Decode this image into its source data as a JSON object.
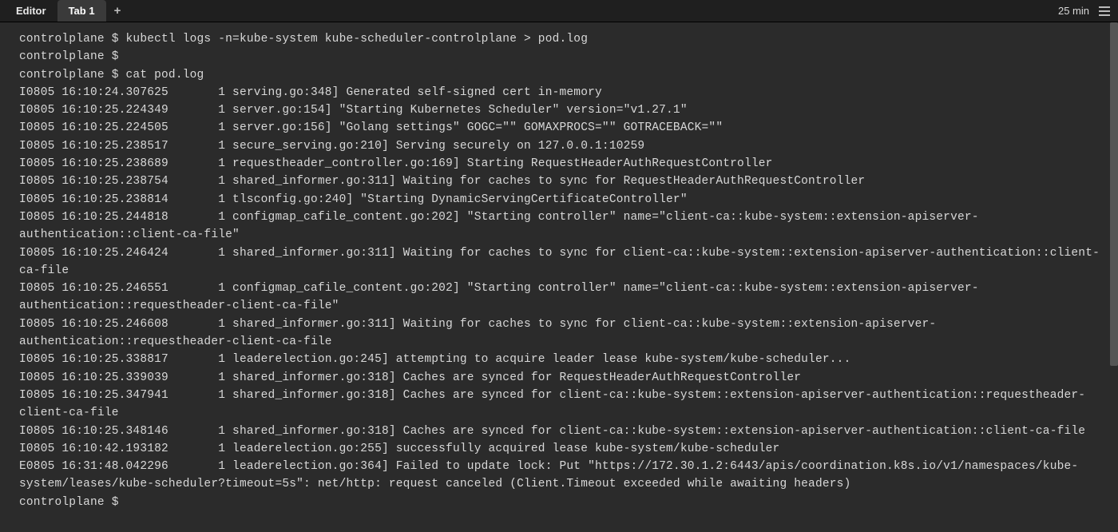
{
  "tabBar": {
    "editorLabel": "Editor",
    "tab1Label": "Tab 1",
    "newTabSymbol": "+",
    "timer": "25 min"
  },
  "terminal": {
    "lines": [
      "controlplane $ kubectl logs -n=kube-system kube-scheduler-controlplane > pod.log",
      "controlplane $",
      "controlplane $ cat pod.log",
      "I0805 16:10:24.307625       1 serving.go:348] Generated self-signed cert in-memory",
      "I0805 16:10:25.224349       1 server.go:154] \"Starting Kubernetes Scheduler\" version=\"v1.27.1\"",
      "I0805 16:10:25.224505       1 server.go:156] \"Golang settings\" GOGC=\"\" GOMAXPROCS=\"\" GOTRACEBACK=\"\"",
      "I0805 16:10:25.238517       1 secure_serving.go:210] Serving securely on 127.0.0.1:10259",
      "I0805 16:10:25.238689       1 requestheader_controller.go:169] Starting RequestHeaderAuthRequestController",
      "I0805 16:10:25.238754       1 shared_informer.go:311] Waiting for caches to sync for RequestHeaderAuthRequestController",
      "I0805 16:10:25.238814       1 tlsconfig.go:240] \"Starting DynamicServingCertificateController\"",
      "I0805 16:10:25.244818       1 configmap_cafile_content.go:202] \"Starting controller\" name=\"client-ca::kube-system::extension-apiserver-authentication::client-ca-file\"",
      "I0805 16:10:25.246424       1 shared_informer.go:311] Waiting for caches to sync for client-ca::kube-system::extension-apiserver-authentication::client-ca-file",
      "I0805 16:10:25.246551       1 configmap_cafile_content.go:202] \"Starting controller\" name=\"client-ca::kube-system::extension-apiserver-authentication::requestheader-client-ca-file\"",
      "I0805 16:10:25.246608       1 shared_informer.go:311] Waiting for caches to sync for client-ca::kube-system::extension-apiserver-authentication::requestheader-client-ca-file",
      "I0805 16:10:25.338817       1 leaderelection.go:245] attempting to acquire leader lease kube-system/kube-scheduler...",
      "I0805 16:10:25.339039       1 shared_informer.go:318] Caches are synced for RequestHeaderAuthRequestController",
      "I0805 16:10:25.347941       1 shared_informer.go:318] Caches are synced for client-ca::kube-system::extension-apiserver-authentication::requestheader-client-ca-file",
      "I0805 16:10:25.348146       1 shared_informer.go:318] Caches are synced for client-ca::kube-system::extension-apiserver-authentication::client-ca-file",
      "I0805 16:10:42.193182       1 leaderelection.go:255] successfully acquired lease kube-system/kube-scheduler",
      "E0805 16:31:48.042296       1 leaderelection.go:364] Failed to update lock: Put \"https://172.30.1.2:6443/apis/coordination.k8s.io/v1/namespaces/kube-system/leases/kube-scheduler?timeout=5s\": net/http: request canceled (Client.Timeout exceeded while awaiting headers)",
      "controlplane $"
    ]
  }
}
